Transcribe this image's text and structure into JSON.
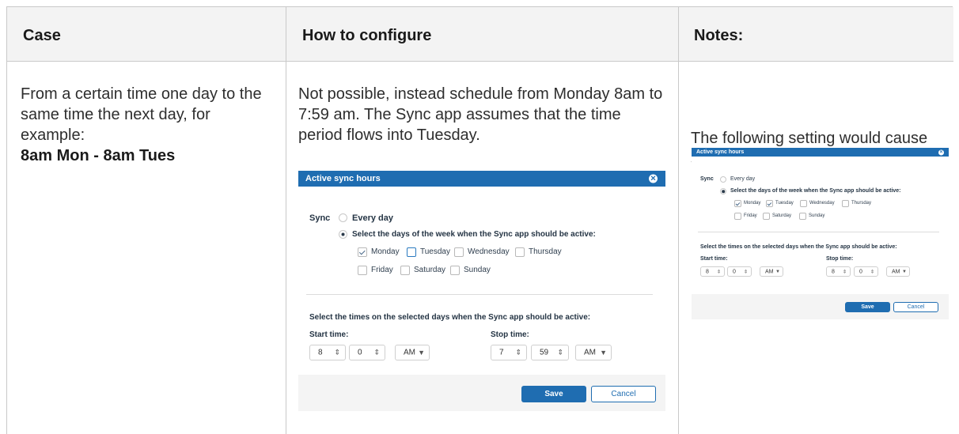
{
  "table": {
    "headers": [
      "Case",
      "How to configure",
      "Notes:"
    ],
    "case": {
      "text": "From a certain time one day to the same time the next day, for example:",
      "example": "8am Mon - 8am Tues"
    },
    "configure_text": "Not possible, instead schedule from Monday 8am to 7:59 am. The Sync app assumes that the time period flows into Tuesday.",
    "notes_text": "The following setting would cause sync to never occur:"
  },
  "dialogs": [
    {
      "title": "Active sync hours",
      "close_icon": "close-icon",
      "sync_label": "Sync",
      "every_day_label": "Every day",
      "select_days_label": "Select the days of the week when the Sync app should be active:",
      "days": [
        {
          "label": "Monday",
          "checked": true
        },
        {
          "label": "Tuesday",
          "checked": false
        },
        {
          "label": "Wednesday",
          "checked": false
        },
        {
          "label": "Thursday",
          "checked": false
        },
        {
          "label": "Friday",
          "checked": false
        },
        {
          "label": "Saturday",
          "checked": false
        },
        {
          "label": "Sunday",
          "checked": false
        }
      ],
      "times_label": "Select the times on the selected days when the Sync app should be active:",
      "start_label": "Start time:",
      "stop_label": "Stop time:",
      "start": {
        "hour": "8",
        "minute": "0",
        "ampm": "AM"
      },
      "stop": {
        "hour": "7",
        "minute": "59",
        "ampm": "AM"
      },
      "save_label": "Save",
      "cancel_label": "Cancel"
    },
    {
      "title": "Active sync hours",
      "close_icon": "close-icon",
      "sync_label": "Sync",
      "every_day_label": "Every day",
      "select_days_label": "Select the days of the week when the Sync app should be active:",
      "days": [
        {
          "label": "Monday",
          "checked": true
        },
        {
          "label": "Tuesday",
          "checked": true
        },
        {
          "label": "Wednesday",
          "checked": false
        },
        {
          "label": "Thursday",
          "checked": false
        },
        {
          "label": "Friday",
          "checked": false
        },
        {
          "label": "Saturday",
          "checked": false
        },
        {
          "label": "Sunday",
          "checked": false
        }
      ],
      "times_label": "Select the times on the selected days when the Sync app should be active:",
      "start_label": "Start time:",
      "stop_label": "Stop time:",
      "start": {
        "hour": "8",
        "minute": "0",
        "ampm": "AM"
      },
      "stop": {
        "hour": "8",
        "minute": "0",
        "ampm": "AM"
      },
      "save_label": "Save",
      "cancel_label": "Cancel"
    }
  ],
  "colors": {
    "dialog_header": "#1f6db1",
    "table_header_bg": "#f3f3f3",
    "border": "#c9c9c9"
  }
}
